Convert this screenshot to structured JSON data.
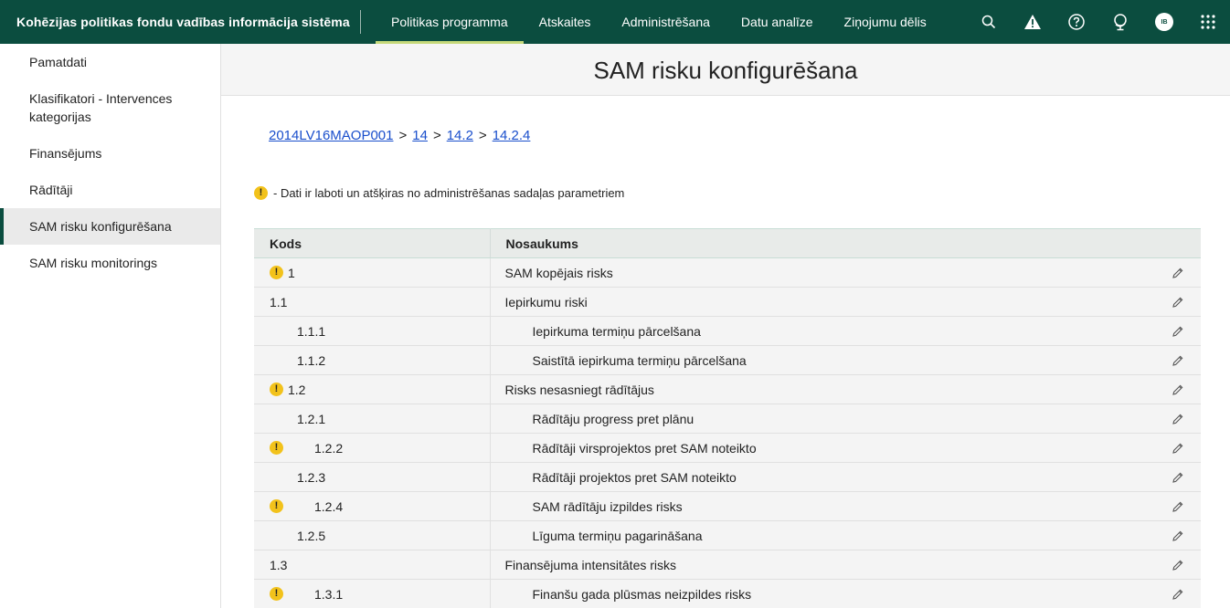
{
  "app": {
    "title": "Kohēzijas politikas fondu vadības informācija sistēma"
  },
  "topnav": [
    {
      "label": "Politikas programma",
      "active": true
    },
    {
      "label": "Atskaites",
      "active": false
    },
    {
      "label": "Administrēšana",
      "active": false
    },
    {
      "label": "Datu analīze",
      "active": false
    },
    {
      "label": "Ziņojumu dēlis",
      "active": false
    }
  ],
  "top_icons": [
    "search-icon",
    "warning-icon",
    "help-icon",
    "globe-icon",
    "avatar",
    "apps-grid-icon"
  ],
  "user": {
    "initials": "IB"
  },
  "sidebar": {
    "items": [
      {
        "label": "Pamatdati",
        "active": false
      },
      {
        "label": "Klasifikatori - Intervences kategorijas",
        "active": false
      },
      {
        "label": "Finansējums",
        "active": false
      },
      {
        "label": "Rādītāji",
        "active": false
      },
      {
        "label": "SAM risku konfigurēšana",
        "active": true
      },
      {
        "label": "SAM risku monitorings",
        "active": false
      }
    ]
  },
  "page": {
    "title": "SAM risku konfigurēšana"
  },
  "breadcrumb": {
    "items": [
      "2014LV16MAOP001",
      "14",
      "14.2",
      "14.2.4"
    ],
    "separator": ">"
  },
  "note": {
    "icon": "!",
    "text": "- Dati ir laboti un atšķiras no administrēšanas sadaļas parametriem"
  },
  "table": {
    "headers": {
      "code": "Kods",
      "name": "Nosaukums"
    },
    "rows": [
      {
        "code": "1",
        "name": "SAM kopējais risks",
        "level": 0,
        "warn": true
      },
      {
        "code": "1.1",
        "name": "Iepirkumu riski",
        "level": 0,
        "warn": false
      },
      {
        "code": "1.1.1",
        "name": "Iepirkuma termiņu pārcelšana",
        "level": 1,
        "warn": false
      },
      {
        "code": "1.1.2",
        "name": "Saistītā iepirkuma termiņu pārcelšana",
        "level": 1,
        "warn": false
      },
      {
        "code": "1.2",
        "name": "Risks nesasniegt rādītājus",
        "level": 0,
        "warn": true
      },
      {
        "code": "1.2.1",
        "name": "Rādītāju progress pret plānu",
        "level": 1,
        "warn": false
      },
      {
        "code": "1.2.2",
        "name": "Rādītāji virsprojektos pret SAM noteikto",
        "level": 1,
        "warn": true
      },
      {
        "code": "1.2.3",
        "name": "Rādītāji projektos pret SAM noteikto",
        "level": 1,
        "warn": false
      },
      {
        "code": "1.2.4",
        "name": "SAM rādītāju izpildes risks",
        "level": 1,
        "warn": true
      },
      {
        "code": "1.2.5",
        "name": "Līguma termiņu pagarināšana",
        "level": 1,
        "warn": false
      },
      {
        "code": "1.3",
        "name": "Finansējuma intensitātes risks",
        "level": 0,
        "warn": false
      },
      {
        "code": "1.3.1",
        "name": "Finanšu gada plūsmas neizpildes risks",
        "level": 1,
        "warn": true
      }
    ]
  },
  "colors": {
    "topbar": "#0b4d3f",
    "active_underline": "#c6d97a",
    "warn": "#f2c21b",
    "link": "#1a4fcc"
  }
}
